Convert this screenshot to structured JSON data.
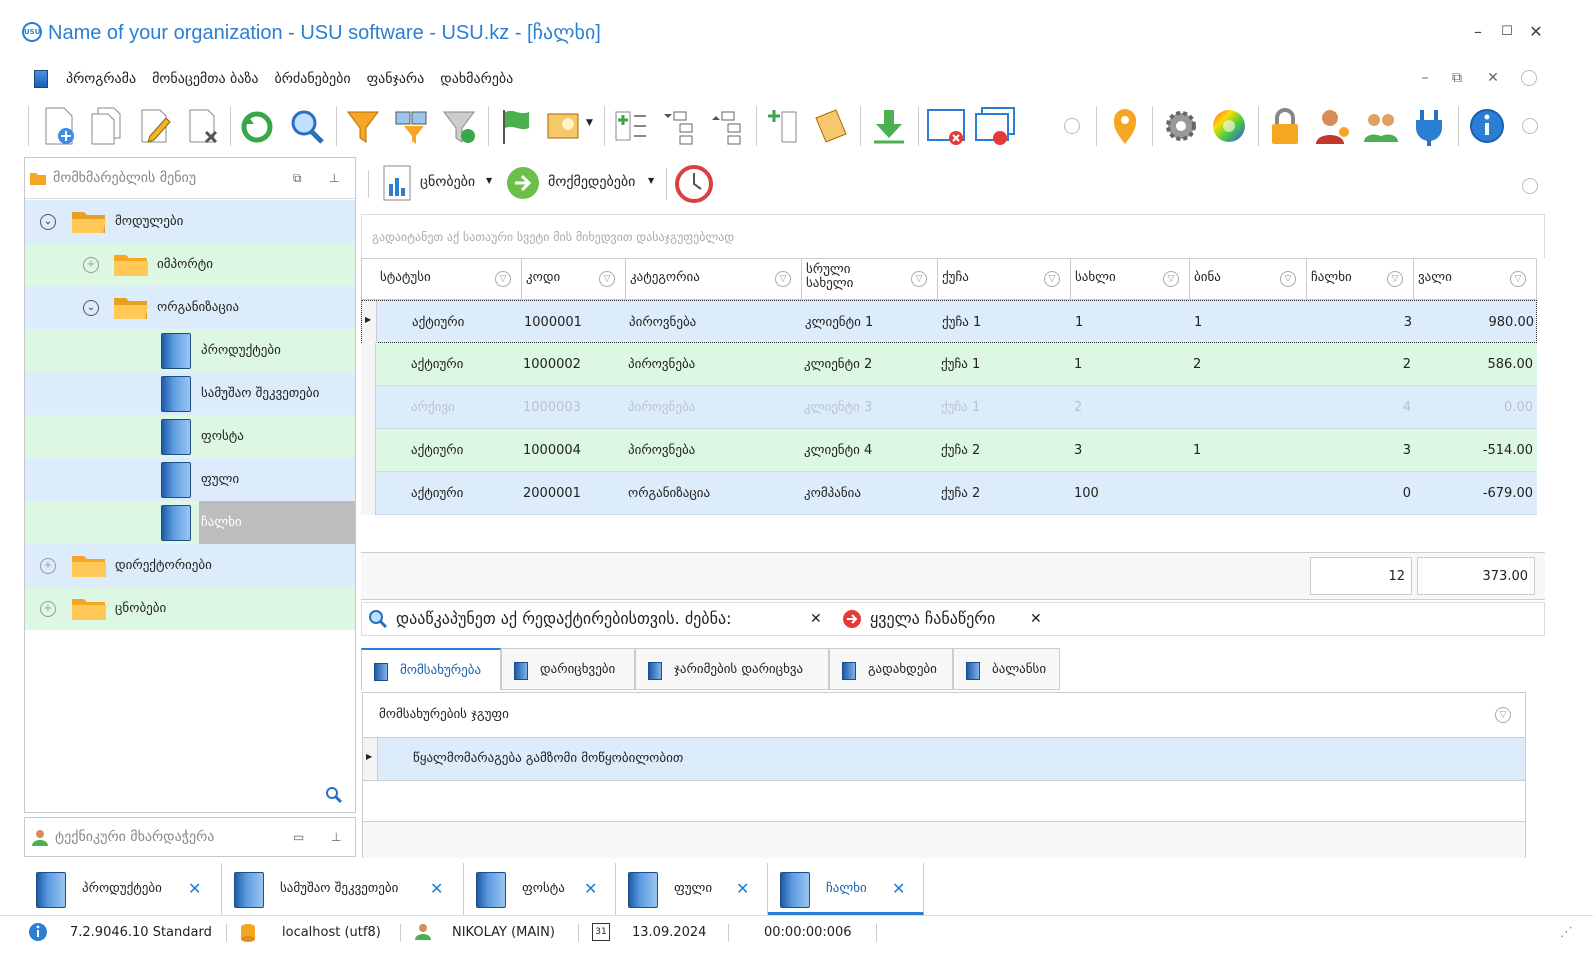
{
  "window": {
    "title": "Name of your organization - USU software - USU.kz - [ჩალხი]",
    "logo_text": "USU",
    "minimize": "–",
    "maximize": "☐",
    "close": "✕"
  },
  "menu": {
    "items": [
      "პროგრამა",
      "მონაცემთა ბაზა",
      "ბრძანებები",
      "ფანჯარა",
      "დახმარება"
    ]
  },
  "mdi_controls": [
    "–",
    "⧉",
    "✕"
  ],
  "left_panel": {
    "title": "მომხმარებლის მენიუ",
    "tree": [
      {
        "label": "მოდულები",
        "expander": "⌄"
      },
      {
        "label": "იმპორტი",
        "expander": "+"
      },
      {
        "label": "ორგანიზაცია",
        "expander": "⌄"
      },
      {
        "label": "პროდუქტები"
      },
      {
        "label": "სამუშაო შეკვეთები"
      },
      {
        "label": "ფოსტა"
      },
      {
        "label": "ფული"
      },
      {
        "label": "ჩალხი"
      },
      {
        "label": "დირექტორიები",
        "expander": "+"
      },
      {
        "label": "ცნობები",
        "expander": "+"
      }
    ]
  },
  "tech_panel": {
    "title": "ტექნიკური მხარდაჭერა"
  },
  "sub_toolbar": {
    "reports_label": "ცნობები",
    "actions_label": "მოქმედებები"
  },
  "group_hint": "გადაიტანეთ აქ სათაური სვეტი მის მიხედვით დასაჯგუფებლად",
  "grid": {
    "columns": [
      "სტატუსი",
      "კოდი",
      "კატეგორია",
      "სრული სახელი",
      "ქუჩა",
      "სახლი",
      "ბინა",
      "ჩალხი",
      "ვალი"
    ],
    "rows": [
      {
        "status": "აქტიური",
        "code": "1000001",
        "category": "პიროვნება",
        "name": "კლიენტი 1",
        "street": "ქუჩა 1",
        "house": "1",
        "apt": "1",
        "count": "3",
        "debt": "980.00"
      },
      {
        "status": "აქტიური",
        "code": "1000002",
        "category": "პიროვნება",
        "name": "კლიენტი 2",
        "street": "ქუჩა 1",
        "house": "1",
        "apt": "2",
        "count": "2",
        "debt": "586.00"
      },
      {
        "status": "არქივი",
        "code": "1000003",
        "category": "პიროვნება",
        "name": "კლიენტი 3",
        "street": "ქუჩა 1",
        "house": "2",
        "apt": "",
        "count": "4",
        "debt": "0.00"
      },
      {
        "status": "აქტიური",
        "code": "1000004",
        "category": "პიროვნება",
        "name": "კლიენტი 4",
        "street": "ქუჩა 2",
        "house": "3",
        "apt": "1",
        "count": "3",
        "debt": "-514.00"
      },
      {
        "status": "აქტიური",
        "code": "2000001",
        "category": "ორგანიზაცია",
        "name": "კომპანია",
        "street": "ქუჩა 2",
        "house": "100",
        "apt": "",
        "count": "0",
        "debt": "-679.00"
      }
    ],
    "totals": {
      "count": "12",
      "debt": "373.00"
    }
  },
  "findbar": {
    "text": "დააწკაპუნეთ აქ რედაქტირებისთვის. ძებნა:",
    "all_records": "ყველა ჩანაწერი",
    "close": "✕"
  },
  "tabs": [
    "მომსახურება",
    "დარიცხვები",
    "ჯარიმების დარიცხვა",
    "გადახდები",
    "ბალანსი"
  ],
  "sub_grid": {
    "column": "მომსახურების ჯგუფი",
    "rows": [
      "წყალმომარაგება გამზომი მოწყობილობით"
    ]
  },
  "doc_tabs": [
    "პროდუქტები",
    "სამუშაო შეკვეთები",
    "ფოსტა",
    "ფული",
    "ჩალხი"
  ],
  "status": {
    "version": "7.2.9046.10 Standard",
    "server": "localhost (utf8)",
    "user": "NIKOLAY (MAIN)",
    "date": "13.09.2024",
    "calendar_day": "31",
    "timer": "00:00:00:006"
  },
  "colors": {
    "accent": "#2a7fd4",
    "row_blue": "#dcecfa",
    "row_green": "#dcf7e2",
    "selected_tree": "#bdbdbd"
  }
}
